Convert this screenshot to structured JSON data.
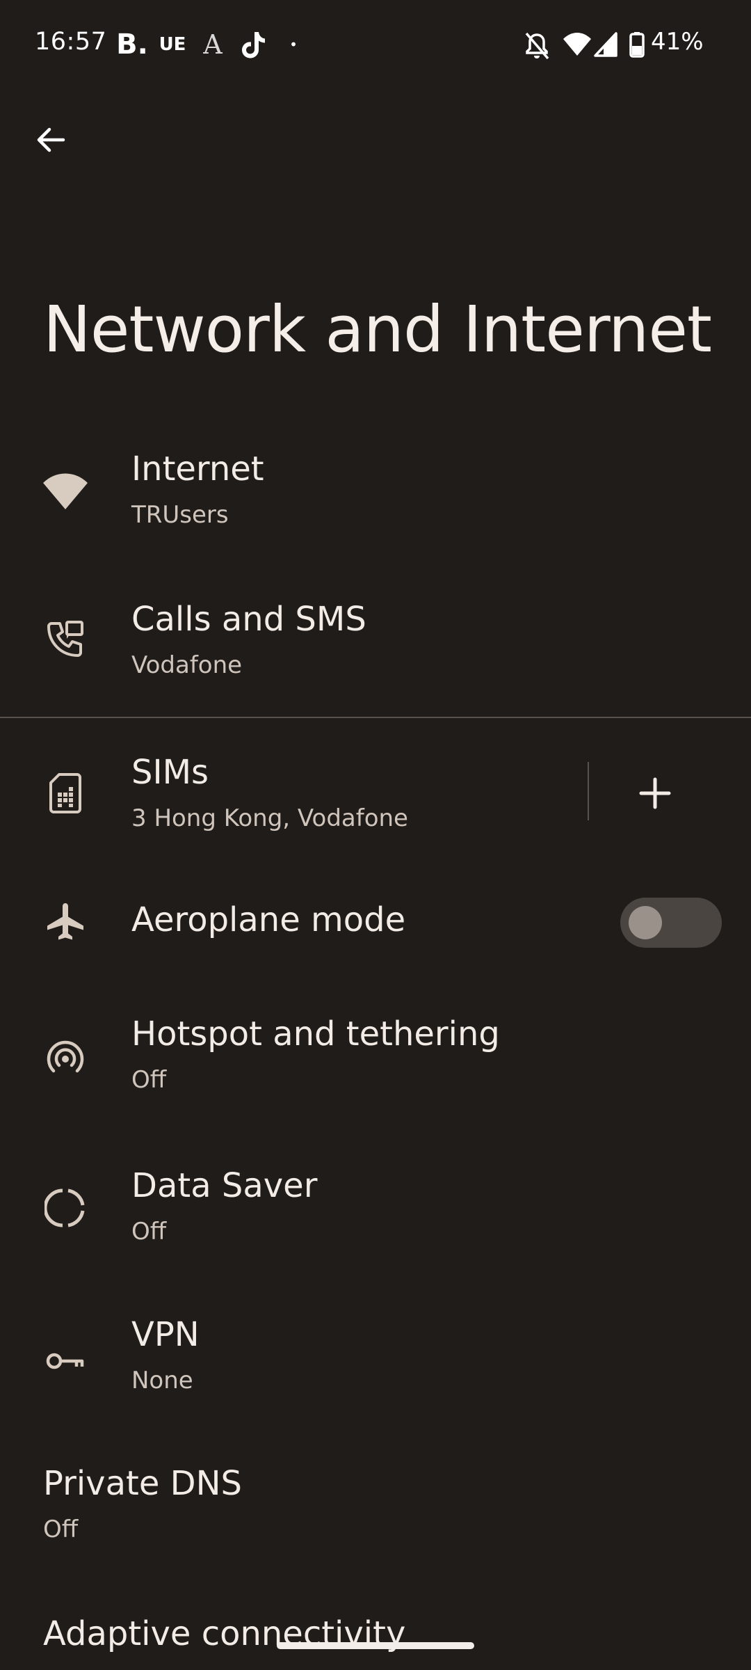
{
  "status_bar": {
    "time": "16:57",
    "notifications": {
      "b": "B.",
      "ue": "UE",
      "a": "A",
      "dot": "•"
    },
    "battery": "41%"
  },
  "page": {
    "title": "Network and Internet"
  },
  "items": {
    "internet": {
      "title": "Internet",
      "subtitle": "TRUsers",
      "icon": "wifi-icon"
    },
    "calls": {
      "title": "Calls and SMS",
      "subtitle": "Vodafone",
      "icon": "phone-forwarded-icon"
    },
    "sims": {
      "title": "SIMs",
      "subtitle": "3 Hong Kong, Vodafone",
      "icon": "sim-card-icon",
      "action_icon": "add-icon"
    },
    "aeroplane": {
      "title": "Aeroplane mode",
      "icon": "airplane-icon",
      "toggle_on": false
    },
    "hotspot": {
      "title": "Hotspot and tethering",
      "subtitle": "Off",
      "icon": "hotspot-icon"
    },
    "data_saver": {
      "title": "Data Saver",
      "subtitle": "Off",
      "icon": "data-saver-icon"
    },
    "vpn": {
      "title": "VPN",
      "subtitle": "None",
      "icon": "key-icon"
    },
    "private_dns": {
      "title": "Private DNS",
      "subtitle": "Off"
    },
    "adaptive": {
      "title": "Adaptive connectivity"
    }
  },
  "colors": {
    "background": "#201c19",
    "text_primary": "#f3ece6",
    "text_secondary": "#cfc5bc",
    "icon": "#d8cbc0"
  }
}
